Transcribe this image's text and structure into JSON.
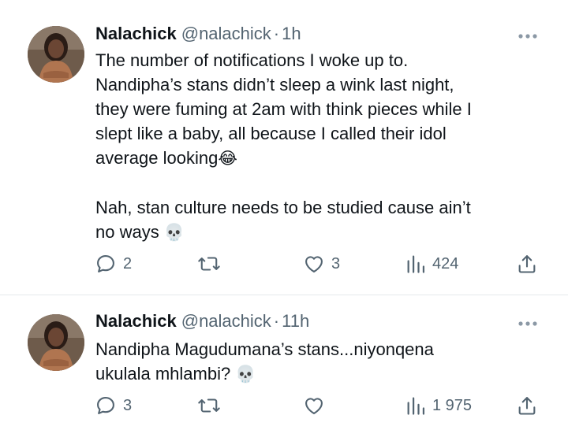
{
  "tweets": [
    {
      "name": "Nalachick",
      "handle": "@nalachick",
      "separator": "·",
      "time": "1h",
      "text_lines": [
        "The number of notifications I woke up to.",
        "Nandipha’s stans didn’t sleep a wink last night,",
        "they were fuming at 2am with think pieces while I",
        "slept like a baby, all because I called their idol",
        "average looking"
      ],
      "emoji_1": "😂",
      "text_lines_2": [
        "Nah, stan culture needs to be studied cause ain’t",
        "no ways"
      ],
      "emoji_2": "💀",
      "replies": "2",
      "reposts": "",
      "likes": "3",
      "views": "424",
      "icons": [
        "chat-bubble-icon",
        "repost-icon",
        "heart-icon",
        "bar-chart-icon",
        "share-icon",
        "more-dots-icon"
      ]
    },
    {
      "name": "Nalachick",
      "handle": "@nalachick",
      "separator": "·",
      "time": "11h",
      "text_lines": [
        "Nandipha Magudumana’s stans...niyonqena",
        "ukulala mhlambi?"
      ],
      "emoji_1": "💀",
      "replies": "3",
      "reposts": "",
      "likes": "",
      "views": "1 975"
    }
  ],
  "colors": {
    "text": "#0f1419",
    "secondary": "#536471",
    "divider": "#e6e9eb"
  }
}
